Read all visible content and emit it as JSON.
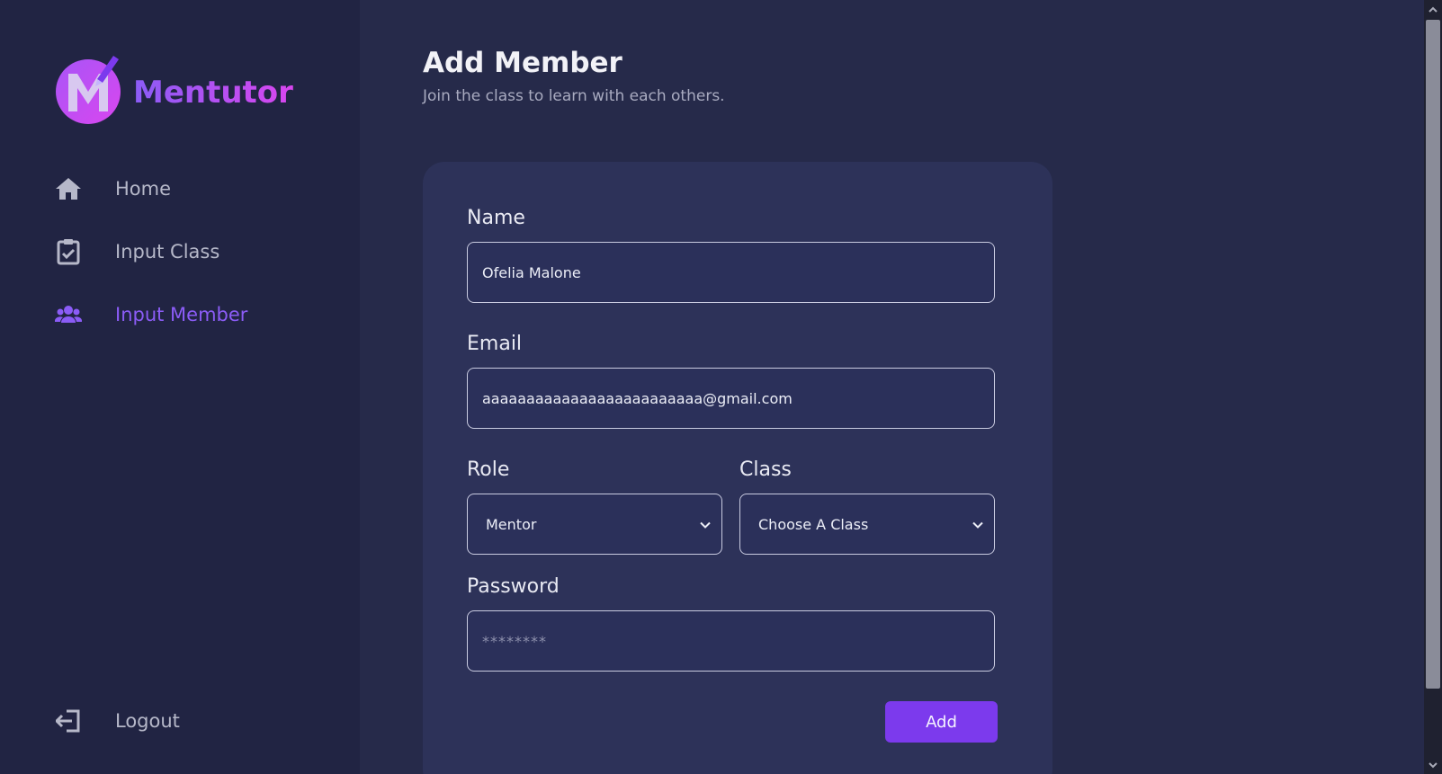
{
  "brand": {
    "name": "Mentutor"
  },
  "sidebar": {
    "items": [
      {
        "label": "Home",
        "icon": "home-icon",
        "active": false
      },
      {
        "label": "Input Class",
        "icon": "clipboard-check-icon",
        "active": false
      },
      {
        "label": "Input Member",
        "icon": "users-icon",
        "active": true
      }
    ],
    "logout_label": "Logout"
  },
  "page": {
    "title": "Add Member",
    "subtitle": "Join the class to learn with each others."
  },
  "form": {
    "name_label": "Name",
    "name_value": "Ofelia Malone",
    "email_label": "Email",
    "email_value": "aaaaaaaaaaaaaaaaaaaaaaaaa@gmail.com",
    "role_label": "Role",
    "role_selected": "Mentor",
    "class_label": "Class",
    "class_selected": "Choose A Class",
    "password_label": "Password",
    "password_placeholder": "********",
    "submit_label": "Add"
  },
  "colors": {
    "accent": "#7c3aed",
    "active_nav": "#8b5cf6",
    "sidebar_bg": "#212443",
    "card_bg": "#2d3259"
  }
}
